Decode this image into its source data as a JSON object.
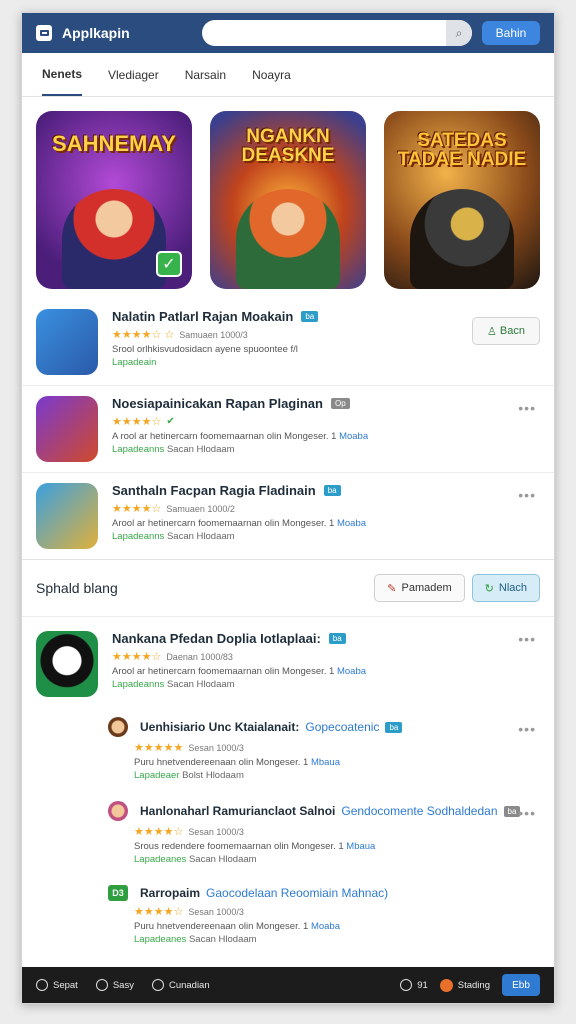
{
  "app": {
    "title": "Applkapin",
    "search_placeholder": "",
    "top_button": "Bahin"
  },
  "tabs": [
    "Nenets",
    "Vlediager",
    "Narsain",
    "Noayra"
  ],
  "banners": [
    {
      "title": "SAHNEMAY"
    },
    {
      "title": "NGANKN DEASKNE"
    },
    {
      "title": "SATEDAS TADAE NADIE"
    }
  ],
  "apps": [
    {
      "title": "Nalatin Patlarl Rajan Moakain",
      "tag": "ba",
      "stars": "★★★★☆ ☆",
      "meta": "Samuaen 1000/3",
      "desc": "Srool orlhkisvudosidacn ayene spuoontee f/l",
      "green": "Lapadeain",
      "button": "Bacn"
    },
    {
      "title": "Noesiapainicakan Rapan Plaginan",
      "tag": "Op",
      "stars": "★★★★☆",
      "desc": "A rool ar hetinercarn foomemaarnan olin Mongeser. 1",
      "desc_link": "Moaba",
      "green": "Lapadeanns",
      "green2": "Sacan Hlodaam"
    },
    {
      "title": "Santhaln Facpan Ragia Fladinain",
      "tag": "ba",
      "stars": "★★★★☆",
      "meta": "Samuaen 1000/2",
      "desc": "Arool ar hetinercarn foomemaarnan olin Mongeser. 1",
      "desc_link": "Moaba",
      "green": "Lapadeanns",
      "green2": "Sacan Hlodaam"
    }
  ],
  "section": {
    "title": "Sphald blang",
    "btn1": "Pamadem",
    "btn2": "Nlach"
  },
  "featured": {
    "title": "Nankana Pfedan Doplia Iotlaplaai:",
    "tag": "ba",
    "stars": "★★★★☆",
    "meta": "Daenan 1000/83",
    "desc": "Arool ar hetinercarn foomemaarnan olin Mongeser. 1",
    "desc_link": "Moaba",
    "green": "Lapadeanns",
    "green2": "Sacan Hlodaam"
  },
  "subitems": [
    {
      "title": "Uenhisiario Unc Ktaialanait:",
      "hl": "Gopecoatenic",
      "tag": "ba",
      "stars": "★★★★★",
      "meta": "Sesan 1000/3",
      "desc": "Puru hnetvendereenaan olin Mongeser. 1",
      "desc_link": "Mbaua",
      "green": "Lapadeaer",
      "green2": "Bolst Hlodaam"
    },
    {
      "title": "Hanlonaharl Ramurianclaot Salnoi",
      "hl": "Gendocomente Sodhaldedan",
      "tag": "ba",
      "stars": "★★★★☆",
      "meta": "Sesan 1000/3",
      "desc": "Srous redendere foomemaarnan olin Mongeser. 1",
      "desc_link": "Mbaua",
      "green": "Lapadeanes",
      "green2": "Sacan Hlodaam"
    },
    {
      "title": "Rarropaim",
      "hl": "Gaocodelaan Reoomiain Mahnac)",
      "tag": "",
      "stars": "★★★★☆",
      "meta": "Sesan 1000/3",
      "desc": "Puru hnetvendereenaan olin Mongeser. 1",
      "desc_link": "Moaba",
      "green": "Lapadeanes",
      "green2": "Sacan Hlodaam",
      "badge": "D3"
    }
  ],
  "bottom": {
    "items": [
      "Sepat",
      "Sasy",
      "Cunadian"
    ],
    "count": "91",
    "user": "Stading",
    "done": "Ebb"
  },
  "colors": {
    "topbar": "#2b4c7e",
    "accent": "#3d86e0",
    "link": "#2f7bd1",
    "green": "#3aa74a",
    "star": "#f5a623"
  }
}
